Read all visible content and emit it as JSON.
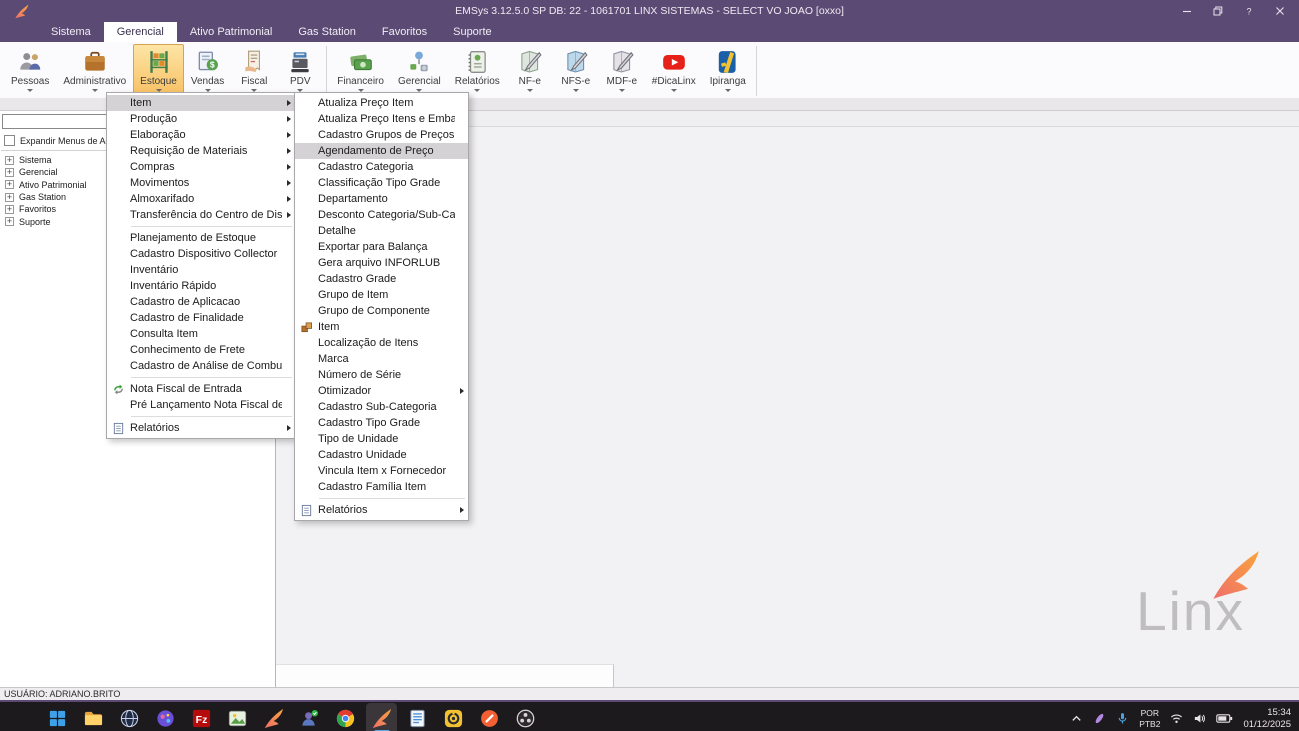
{
  "window": {
    "title": "EMSys 3.12.5.0 SP DB: 22 - 1061701 LINX SISTEMAS - SELECT VO JOAO [oxxo]",
    "controls": [
      "minimize-icon",
      "restore-icon",
      "help-icon",
      "close-icon"
    ]
  },
  "menubar": {
    "tabs": [
      {
        "label": "Sistema",
        "selected": false
      },
      {
        "label": "Gerencial",
        "selected": true
      },
      {
        "label": "Ativo Patrimonial",
        "selected": false
      },
      {
        "label": "Gas Station",
        "selected": false
      },
      {
        "label": "Favoritos",
        "selected": false
      },
      {
        "label": "Suporte",
        "selected": false
      }
    ]
  },
  "ribbon": {
    "buttons": [
      {
        "label": "Pessoas",
        "icon": "people-icon"
      },
      {
        "label": "Administrativo",
        "icon": "briefcase-icon"
      },
      {
        "label": "Estoque",
        "icon": "stock-shelf-icon",
        "selected": true
      },
      {
        "label": "Vendas",
        "icon": "sales-doc-icon"
      },
      {
        "label": "Fiscal",
        "icon": "fiscal-receipt-icon"
      },
      {
        "label": "PDV",
        "icon": "cash-register-icon",
        "separator_after": true
      },
      {
        "label": "Financeiro",
        "icon": "money-icon"
      },
      {
        "label": "Gerencial",
        "icon": "org-chart-icon"
      },
      {
        "label": "Relatórios",
        "icon": "report-book-icon"
      },
      {
        "label": "NF-e",
        "icon": "nfe-doc-icon"
      },
      {
        "label": "NFS-e",
        "icon": "nfse-doc-icon"
      },
      {
        "label": "MDF-e",
        "icon": "mdfe-doc-icon"
      },
      {
        "label": "#DicaLinx",
        "icon": "youtube-icon"
      },
      {
        "label": "Ipiranga",
        "icon": "ipiranga-icon",
        "separator_after": true
      }
    ]
  },
  "sidebar": {
    "search_value": "",
    "expand_label": "Expandir Menus de Acesso",
    "tree": [
      "Sistema",
      "Gerencial",
      "Ativo Patrimonial",
      "Gas Station",
      "Favoritos",
      "Suporte"
    ]
  },
  "estoque_menu": {
    "items": [
      {
        "label": "Item",
        "submenu": true,
        "highlighted": true
      },
      {
        "label": "Produção",
        "submenu": true
      },
      {
        "label": "Elaboração",
        "submenu": true
      },
      {
        "label": "Requisição de Materiais",
        "submenu": true
      },
      {
        "label": "Compras",
        "submenu": true
      },
      {
        "label": "Movimentos",
        "submenu": true
      },
      {
        "label": "Almoxarifado",
        "submenu": true
      },
      {
        "label": "Transferência do Centro de Distribuição",
        "submenu": true
      },
      {
        "label": "Planejamento de Estoque",
        "separator_before": true
      },
      {
        "label": "Cadastro Dispositivo Collector"
      },
      {
        "label": "Inventário"
      },
      {
        "label": "Inventário Rápido"
      },
      {
        "label": "Cadastro de Aplicacao"
      },
      {
        "label": "Cadastro de Finalidade"
      },
      {
        "label": "Consulta Item"
      },
      {
        "label": "Conhecimento de Frete"
      },
      {
        "label": "Cadastro de Análise de Combustíveis"
      },
      {
        "label": "Nota Fiscal de Entrada",
        "icon": "nota-fiscal-icon",
        "separator_before": true
      },
      {
        "label": "Pré Lançamento Nota Fiscal de Entrada"
      },
      {
        "label": "Relatórios",
        "icon": "relatorios-menu-icon",
        "submenu": true,
        "separator_before": true
      }
    ]
  },
  "item_submenu": {
    "items": [
      {
        "label": "Atualiza Preço Item"
      },
      {
        "label": "Atualiza Preço Itens e Embalagens"
      },
      {
        "label": "Cadastro Grupos de Preços"
      },
      {
        "label": "Agendamento de Preço",
        "highlighted": true
      },
      {
        "label": "Cadastro Categoria"
      },
      {
        "label": "Classificação Tipo Grade"
      },
      {
        "label": "Departamento"
      },
      {
        "label": "Desconto Categoria/Sub-Categoria"
      },
      {
        "label": "Detalhe"
      },
      {
        "label": "Exportar para Balança"
      },
      {
        "label": "Gera arquivo INFORLUB"
      },
      {
        "label": "Cadastro Grade"
      },
      {
        "label": "Grupo de Item"
      },
      {
        "label": "Grupo de Componente"
      },
      {
        "label": "Item",
        "icon": "item-box-icon"
      },
      {
        "label": "Localização de Itens"
      },
      {
        "label": "Marca"
      },
      {
        "label": "Número de Série"
      },
      {
        "label": "Otimizador",
        "submenu": true
      },
      {
        "label": "Cadastro Sub-Categoria"
      },
      {
        "label": "Cadastro Tipo Grade"
      },
      {
        "label": "Tipo de Unidade"
      },
      {
        "label": "Cadastro Unidade"
      },
      {
        "label": "Vincula Item x Fornecedor"
      },
      {
        "label": "Cadastro Família Item"
      },
      {
        "label": "Relatórios",
        "icon": "relatorios-menu-icon",
        "submenu": true,
        "separator_before": true
      }
    ]
  },
  "watermark": {
    "text": "Linx"
  },
  "statusbar": {
    "user": "USUÁRIO: ADRIANO.BRITO"
  },
  "taskbar": {
    "buttons": [
      {
        "icon": "windows-start-icon",
        "indicator": false
      },
      {
        "icon": "file-explorer-icon",
        "indicator": true
      },
      {
        "icon": "browser-globe-icon",
        "indicator": true
      },
      {
        "icon": "paint-planet-icon",
        "indicator": true
      },
      {
        "icon": "filezilla-icon",
        "indicator": true
      },
      {
        "icon": "photos-icon",
        "indicator": true
      },
      {
        "icon": "linx-emsys-icon",
        "indicator": true
      },
      {
        "icon": "user-badge-icon",
        "indicator": true
      },
      {
        "icon": "chrome-icon",
        "indicator": true
      },
      {
        "icon": "linx-emsys-icon",
        "indicator": true,
        "active": true
      },
      {
        "icon": "notes-icon",
        "indicator": true
      },
      {
        "icon": "yellow-db-icon",
        "indicator": true
      },
      {
        "icon": "pen-app-icon",
        "indicator": true
      },
      {
        "icon": "obs-icon",
        "indicator": true
      }
    ]
  },
  "tray": {
    "lang_line1": "POR",
    "lang_line2": "PTB2",
    "time": "15:34",
    "date": "01/12/2025"
  },
  "colors": {
    "titlebar_purple": "#5b4b74",
    "selected_button_orange": "#f8c267",
    "menu_highlight_gray": "#d4d2d4",
    "taskbar_dark": "#1d1a1d",
    "linx_gradient_start": "#ef6f6a",
    "linx_gradient_end": "#f9a43c"
  }
}
